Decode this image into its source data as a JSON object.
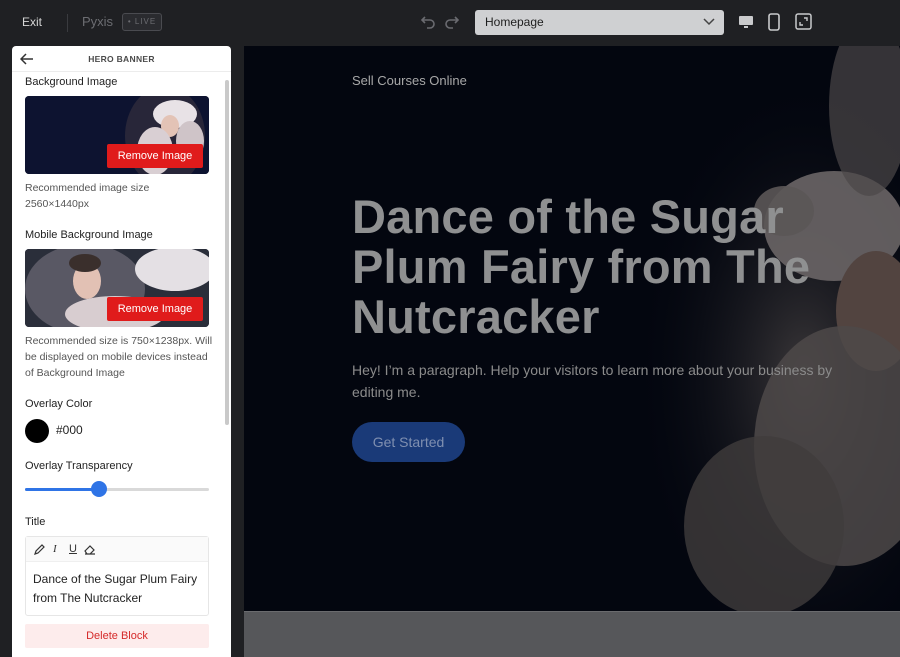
{
  "topbar": {
    "exit_label": "Exit",
    "brand": "Pyxis",
    "live_badge": "• LIVE",
    "page_selector": "Homepage",
    "icons": [
      "undo-icon",
      "redo-icon",
      "chevron-down-icon",
      "desktop-icon",
      "mobile-icon",
      "fullscreen-icon"
    ]
  },
  "panel": {
    "title": "HERO BANNER",
    "bg_image_label": "Background Image",
    "bg_remove": "Remove Image",
    "bg_help": "Recommended image size 2560×1440px",
    "mobile_image_label": "Mobile Background Image",
    "mobile_remove": "Remove Image",
    "mobile_help": "Recommended size is 750×1238px. Will be displayed on mobile devices instead of Background Image",
    "overlay_color_label": "Overlay Color",
    "overlay_color_value": "#000",
    "overlay_transparency_label": "Overlay Transparency",
    "overlay_transparency_percent": 40,
    "title_label": "Title",
    "title_value": "Dance of the Sugar Plum Fairy from The Nutcracker",
    "delete_label": "Delete Block"
  },
  "preview": {
    "kicker": "Sell Courses Online",
    "headline": "Dance of the Sugar Plum Fairy from The Nutcracker",
    "paragraph": "Hey! I’m a paragraph. Help your visitors to learn more about your business by editing me.",
    "cta": "Get Started"
  },
  "colors": {
    "accent": "#2f74e6",
    "danger": "#e01b1b",
    "topbar_bg": "#1f2023"
  }
}
